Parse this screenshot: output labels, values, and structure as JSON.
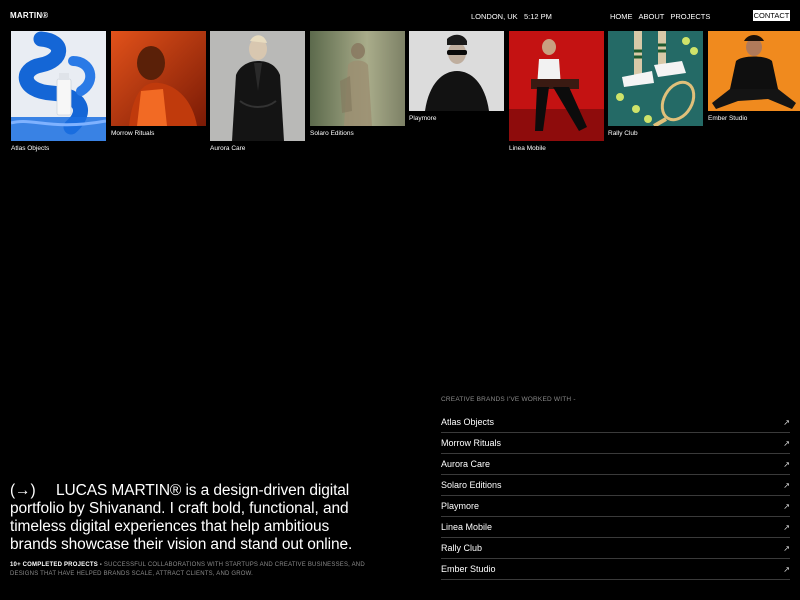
{
  "header": {
    "logo": "MARTIN®",
    "location": "LONDON, UK",
    "time": "5:12 PM",
    "nav": [
      "HOME",
      "ABOUT",
      "PROJECTS"
    ],
    "contact": "CONTACT"
  },
  "gallery": [
    {
      "label": "Atlas Objects"
    },
    {
      "label": "Morrow Rituals"
    },
    {
      "label": "Aurora Care"
    },
    {
      "label": "Solaro Editions"
    },
    {
      "label": "Playmore"
    },
    {
      "label": "Linea Mobile"
    },
    {
      "label": "Rally Club"
    },
    {
      "label": "Ember Studio"
    }
  ],
  "bio": {
    "arrow": "(→)",
    "text": "LUCAS MARTIN® is a design-driven digital portfolio by Shivanand. I craft bold, functional, and timeless digital experiences that help ambitious brands showcase their vision and stand out online."
  },
  "stats": {
    "highlight": "10+ COMPLETED PROJECTS -",
    "text": " SUCCESSFUL COLLABORATIONS WITH STARTUPS AND CREATIVE BUSINESSES, AND DESIGNS THAT HAVE HELPED BRANDS SCALE, ATTRACT CLIENTS, AND GROW."
  },
  "brands": {
    "title": "CREATIVE BRANDS I'VE WORKED WITH -",
    "items": [
      {
        "name": "Atlas Objects",
        "icon": "external-link-icon",
        "glyph": "↗"
      },
      {
        "name": "Morrow Rituals",
        "icon": "external-link-icon",
        "glyph": "↗"
      },
      {
        "name": "Aurora Care",
        "icon": "external-link-icon",
        "glyph": "↗"
      },
      {
        "name": "Solaro Editions",
        "icon": "external-link-icon",
        "glyph": "↗"
      },
      {
        "name": "Playmore",
        "icon": "external-link-icon",
        "glyph": "↗"
      },
      {
        "name": "Linea Mobile",
        "icon": "external-link-icon",
        "glyph": "↗"
      },
      {
        "name": "Rally Club",
        "icon": "external-link-icon",
        "glyph": "↗"
      },
      {
        "name": "Ember Studio",
        "icon": "external-link-icon",
        "glyph": "↗"
      }
    ]
  }
}
